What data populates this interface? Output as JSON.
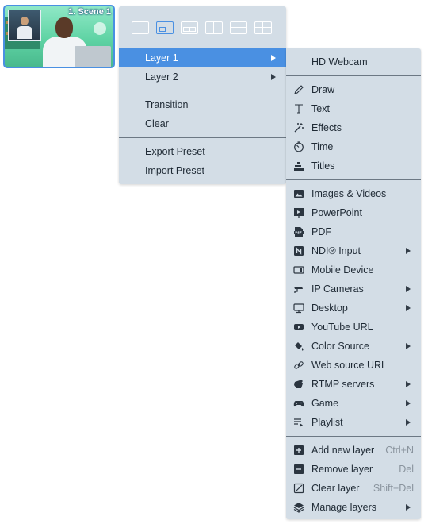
{
  "scene": {
    "label": "1. Scene 1"
  },
  "main_menu": {
    "layout_icons": [
      "layout-single-icon",
      "layout-pip-icon",
      "layout-two-pip-icon",
      "layout-split-vertical-icon",
      "layout-split-horizontal-icon",
      "layout-quad-icon"
    ],
    "items": [
      {
        "label": "Layer 1",
        "submenu": true,
        "highlighted": true
      },
      {
        "label": "Layer 2",
        "submenu": true
      },
      {
        "label": "Transition"
      },
      {
        "label": "Clear"
      },
      {
        "label": "Export Preset"
      },
      {
        "label": "Import Preset"
      }
    ]
  },
  "sub_menu": {
    "items": [
      {
        "label": "HD Webcam",
        "icon": ""
      },
      {
        "label": "Draw",
        "icon": "pencil-icon"
      },
      {
        "label": "Text",
        "icon": "text-icon"
      },
      {
        "label": "Effects",
        "icon": "magic-wand-icon"
      },
      {
        "label": "Time",
        "icon": "timer-icon"
      },
      {
        "label": "Titles",
        "icon": "titles-icon"
      },
      {
        "label": "Images & Videos",
        "icon": "image-icon"
      },
      {
        "label": "PowerPoint",
        "icon": "presentation-icon"
      },
      {
        "label": "PDF",
        "icon": "pdf-icon"
      },
      {
        "label": "NDI® Input",
        "icon": "ndi-icon",
        "submenu": true
      },
      {
        "label": "Mobile Device",
        "icon": "mobile-device-icon"
      },
      {
        "label": "IP Cameras",
        "icon": "ip-camera-icon",
        "submenu": true
      },
      {
        "label": "Desktop",
        "icon": "monitor-icon",
        "submenu": true
      },
      {
        "label": "YouTube URL",
        "icon": "youtube-icon"
      },
      {
        "label": "Color Source",
        "icon": "paint-bucket-icon",
        "submenu": true
      },
      {
        "label": "Web source URL",
        "icon": "link-icon"
      },
      {
        "label": "RTMP servers",
        "icon": "rtmp-icon",
        "submenu": true
      },
      {
        "label": "Game",
        "icon": "gamepad-icon",
        "submenu": true
      },
      {
        "label": "Playlist",
        "icon": "playlist-icon",
        "submenu": true
      },
      {
        "label": "Add new layer",
        "icon": "add-layer-icon",
        "shortcut": "Ctrl+N"
      },
      {
        "label": "Remove layer",
        "icon": "remove-layer-icon",
        "shortcut": "Del"
      },
      {
        "label": "Clear layer",
        "icon": "clear-layer-icon",
        "shortcut": "Shift+Del"
      },
      {
        "label": "Manage layers",
        "icon": "layers-icon",
        "submenu": true
      }
    ]
  },
  "colors": {
    "menu_bg": "#d3dde6",
    "highlight": "#4a90e2",
    "separator": "#6c7884",
    "text": "#1f2a35"
  }
}
